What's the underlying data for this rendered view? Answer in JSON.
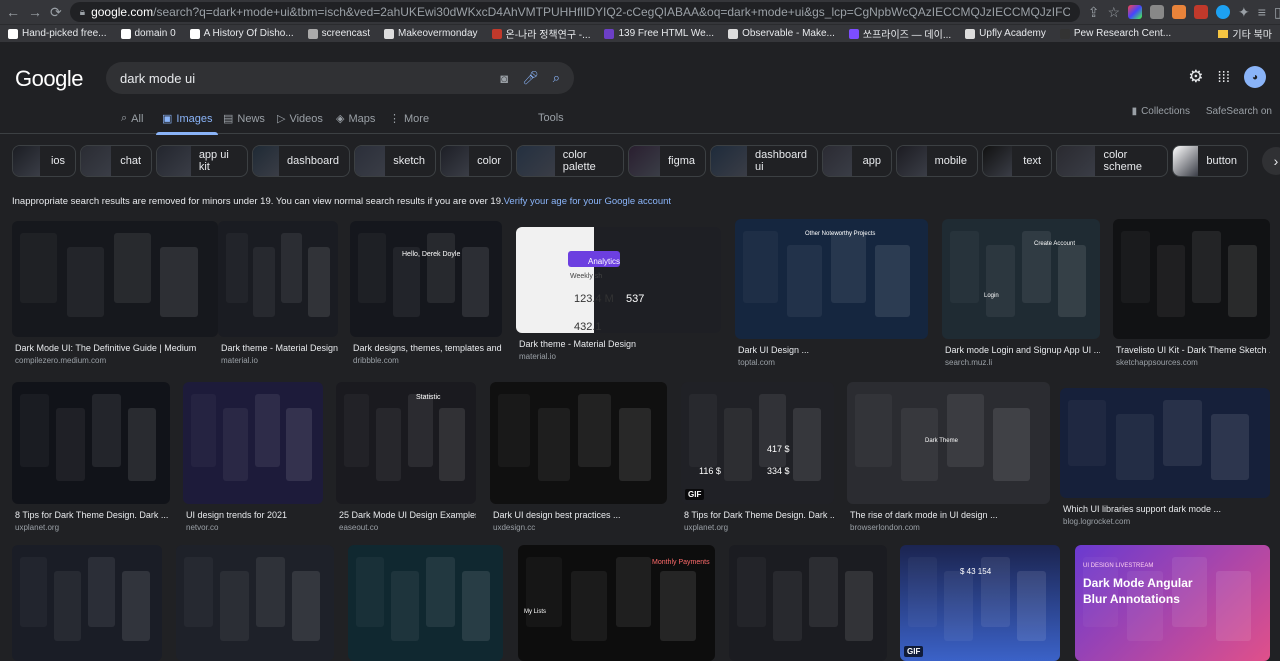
{
  "browser": {
    "url_host": "google.com",
    "url_rest": "/search?q=dark+mode+ui&tbm=isch&ved=2ahUKEwi30dWKxcD4AhVMTPUHHflIDYIQ2-cCegQIABAA&oq=dark+mode+ui&gs_lcp=CgNpbWcQAzIECCMQJzIECCMQJzIFCAAQgAQyBQgAEIAEMgUIABCABDIFCA",
    "bookmarks": [
      {
        "label": "Hand-picked free...",
        "color": "#ffffff"
      },
      {
        "label": "domain 0",
        "color": "#ffffff"
      },
      {
        "label": "A History Of Disho...",
        "color": "#ffffff"
      },
      {
        "label": "screencast",
        "color": "#aaaaaa"
      },
      {
        "label": "Makeovermonday",
        "color": "#dddddd"
      },
      {
        "label": "온-나라 정책연구 -...",
        "color": "#c0392b"
      },
      {
        "label": "139 Free HTML We...",
        "color": "#6c3fc7"
      },
      {
        "label": "Observable - Make...",
        "color": "#dddddd"
      },
      {
        "label": "쏘프라이즈 — 데이...",
        "color": "#7c4dff"
      },
      {
        "label": "Upfly Academy",
        "color": "#dddddd"
      },
      {
        "label": "Pew Research Cent...",
        "color": "#333333"
      }
    ],
    "bookmarks_other": "기타 북마"
  },
  "google": {
    "logo": "Google",
    "query": "dark mode ui",
    "tabs": [
      "All",
      "Images",
      "News",
      "Videos",
      "Maps",
      "More"
    ],
    "active_tab": "Images",
    "tools": "Tools",
    "collections": "Collections",
    "safesearch": "SafeSearch on",
    "chips": [
      {
        "label": "ios",
        "w": 64
      },
      {
        "label": "chat",
        "w": 72
      },
      {
        "label": "app ui kit",
        "w": 92
      },
      {
        "label": "dashboard",
        "w": 98
      },
      {
        "label": "sketch",
        "w": 82
      },
      {
        "label": "color",
        "w": 72
      },
      {
        "label": "color palette",
        "w": 108
      },
      {
        "label": "figma",
        "w": 78
      },
      {
        "label": "dashboard ui",
        "w": 108
      },
      {
        "label": "app",
        "w": 70
      },
      {
        "label": "mobile",
        "w": 82
      },
      {
        "label": "text",
        "w": 70
      },
      {
        "label": "color scheme",
        "w": 112
      },
      {
        "label": "button",
        "w": 76
      }
    ],
    "notice_text": "Inappropriate search results are removed for minors under 19. You can view normal search results if you are over 19.",
    "notice_link": "Verify your age for your Google account",
    "results": [
      {
        "caption": "Dark Mode UI: The Definitive Guide | Medium",
        "source": "compilezero.medium.com"
      },
      {
        "caption": "Dark theme - Material Design",
        "source": "material.io"
      },
      {
        "caption": "Dark designs, themes, templates and ...",
        "source": "dribbble.com"
      },
      {
        "caption": "Dark theme - Material Design",
        "source": "material.io"
      },
      {
        "caption": "Dark UI Design ...",
        "source": "toptal.com"
      },
      {
        "caption": "Dark mode Login and Signup App UI ...",
        "source": "search.muz.li"
      },
      {
        "caption": "Travelisto UI Kit - Dark Theme Sketch ...",
        "source": "sketchappsources.com"
      },
      {
        "caption": "8 Tips for Dark Theme Design. Dark ...",
        "source": "uxplanet.org"
      },
      {
        "caption": "UI design trends for 2021",
        "source": "netvor.co"
      },
      {
        "caption": "25 Dark Mode UI Design Examples ...",
        "source": "easeout.co"
      },
      {
        "caption": "Dark UI design best practices ...",
        "source": "uxdesign.cc"
      },
      {
        "caption": "8 Tips for Dark Theme Design. Dark ...",
        "source": "uxplanet.org"
      },
      {
        "caption": "The rise of dark mode in UI design ...",
        "source": "browserlondon.com"
      },
      {
        "caption": "Which UI libraries support dark mode ...",
        "source": "blog.logrocket.com"
      }
    ],
    "thumb_text": {
      "analytics": "Analytics",
      "val1": "123.4 M",
      "val2": "537",
      "val3": "432.1",
      "weekly": "Weekly sh",
      "other_projects": "Other Noteworthy Projects",
      "create_account": "Create Account",
      "login": "Login",
      "hello": "Hello, Derek Doyle",
      "statistic": "Statistic",
      "monthly_payments": "Monthly Payments",
      "balance_ru": "$ 43 154",
      "dark_mode_title": "Dark Mode Angular Blur Annotations",
      "livestream": "UI DESIGN LIVESTREAM",
      "price1": "116 $",
      "price2": "417 $",
      "price3": "334 $",
      "dark_theme": "Dark Theme",
      "my_lists": "My Lists",
      "gif": "GIF"
    }
  }
}
